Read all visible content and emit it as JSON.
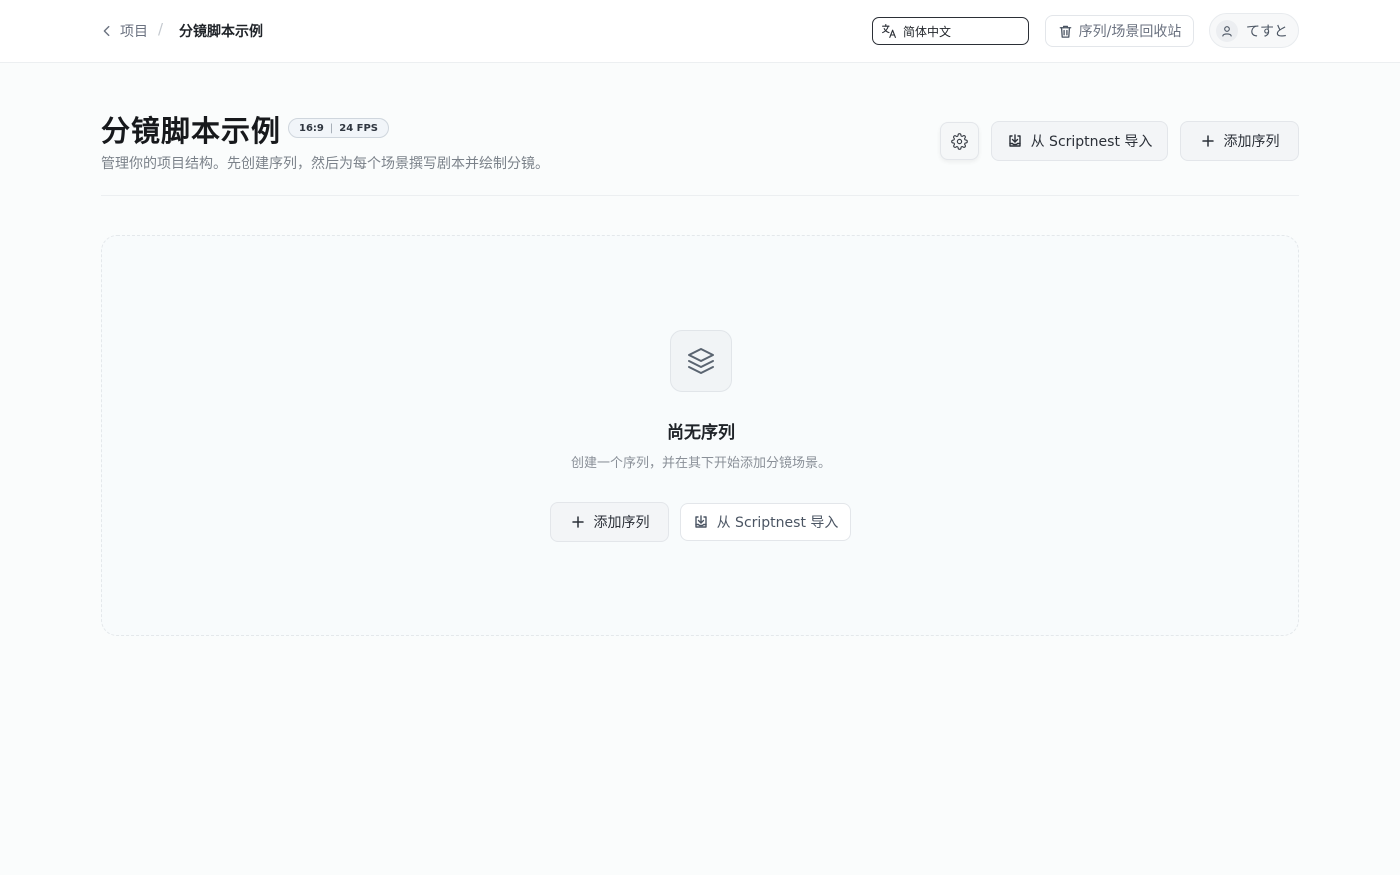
{
  "breadcrumb": {
    "back_label": "项目",
    "separator": "/",
    "current": "分镜脚本示例"
  },
  "header": {
    "language": "简体中文",
    "trash_label": "序列/场景回收站",
    "user_name": "てすと"
  },
  "project": {
    "title": "分镜脚本示例",
    "aspect_ratio": "16:9",
    "fps": "24 FPS",
    "description": "管理你的项目结构。先创建序列，然后为每个场景撰写剧本并绘制分镜。"
  },
  "toolbar": {
    "import_label": "从 Scriptnest 导入",
    "add_sequence_label": "添加序列"
  },
  "empty_state": {
    "title": "尚无序列",
    "description": "创建一个序列，并在其下开始添加分镜场景。",
    "add_label": "添加序列",
    "import_label": "从 Scriptnest 导入"
  },
  "icons": {
    "back": "chevron-left-icon",
    "language": "translate-icon",
    "trash": "trash-icon",
    "user": "user-icon",
    "settings": "gear-icon",
    "import": "import-icon",
    "add": "plus-icon",
    "layers": "layers-icon"
  }
}
